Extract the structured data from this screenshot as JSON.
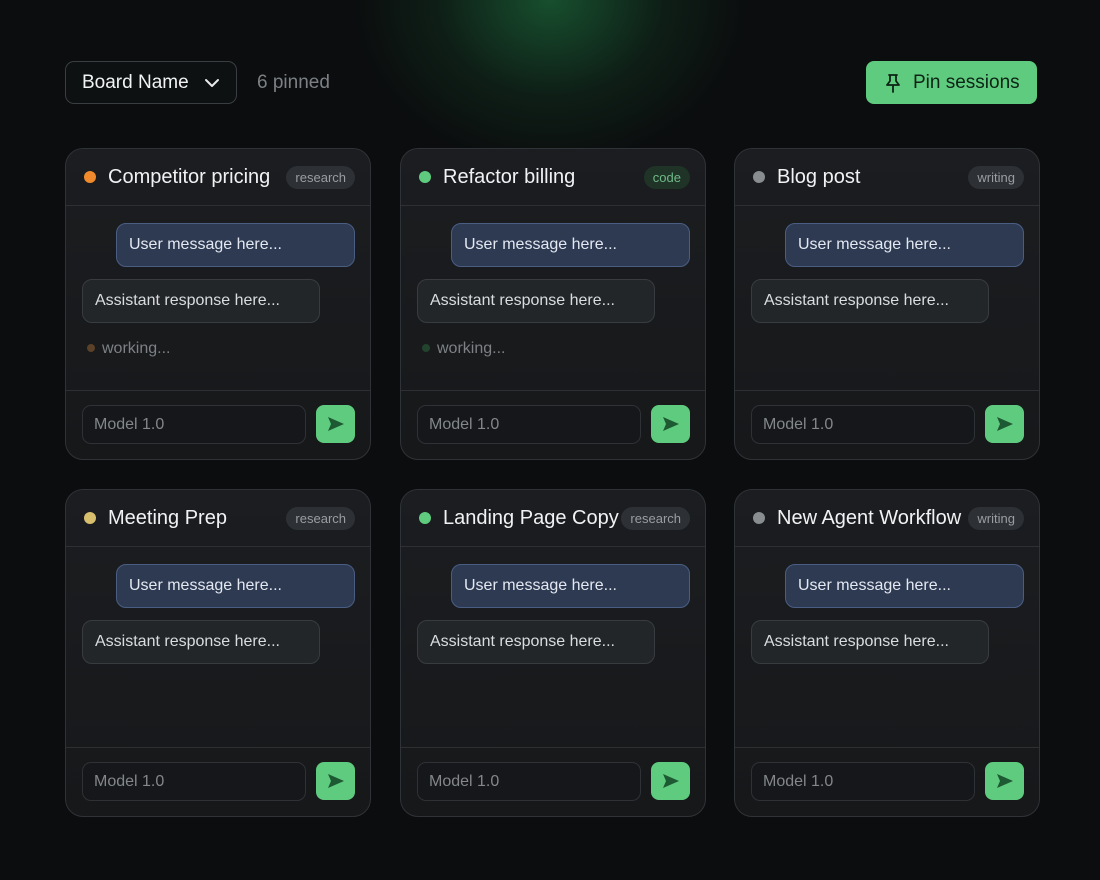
{
  "header": {
    "board_name": "Board Name",
    "pinned_count": "6 pinned",
    "pin_button_label": "Pin sessions"
  },
  "colors": {
    "accent": "#5fcb7f",
    "status_orange": "#f08a2c",
    "status_green": "#5fcb7f",
    "status_gray": "#8a8d90",
    "status_yellow": "#d7bf6e"
  },
  "cards": [
    {
      "title": "Competitor pricing",
      "tag": "research",
      "dot_color": "#f08a2c",
      "user_msg": "User message here...",
      "assistant_msg": "Assistant response here...",
      "status": "working...",
      "model_placeholder": "Model 1.0"
    },
    {
      "title": "Refactor billing",
      "tag": "code",
      "dot_color": "#5fcb7f",
      "user_msg": "User message here...",
      "assistant_msg": "Assistant response here...",
      "status": "working...",
      "model_placeholder": "Model 1.0"
    },
    {
      "title": "Blog post",
      "tag": "writing",
      "dot_color": "#8a8d90",
      "user_msg": "User message here...",
      "assistant_msg": "Assistant response here...",
      "status": "",
      "model_placeholder": "Model 1.0"
    },
    {
      "title": "Meeting Prep",
      "tag": "research",
      "dot_color": "#d7bf6e",
      "user_msg": "User message here...",
      "assistant_msg": "Assistant response here...",
      "status": "",
      "model_placeholder": "Model 1.0"
    },
    {
      "title": "Landing Page Copy",
      "tag": "research",
      "dot_color": "#5fcb7f",
      "user_msg": "User message here...",
      "assistant_msg": "Assistant response here...",
      "status": "",
      "model_placeholder": "Model 1.0"
    },
    {
      "title": "New Agent Workflow",
      "tag": "writing",
      "dot_color": "#8a8d90",
      "user_msg": "User message here...",
      "assistant_msg": "Assistant response here...",
      "status": "",
      "model_placeholder": "Model 1.0"
    }
  ]
}
